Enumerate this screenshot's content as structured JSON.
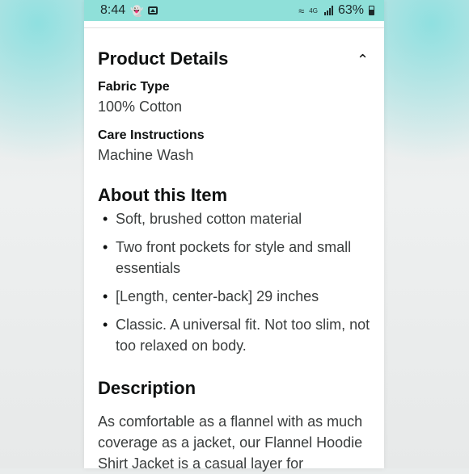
{
  "status_bar": {
    "time": "8:44",
    "network": "4G",
    "battery": "63%",
    "icons": [
      "snapchat-icon",
      "image-icon",
      "wifi-icon",
      "signal-icon",
      "battery-icon"
    ]
  },
  "product_details": {
    "title": "Product Details",
    "collapse_icon": "chevron-up-icon",
    "fields": [
      {
        "label": "Fabric Type",
        "value": "100% Cotton"
      },
      {
        "label": "Care Instructions",
        "value": "Machine Wash"
      }
    ]
  },
  "about": {
    "title": "About this Item",
    "items": [
      "Soft, brushed cotton material",
      "Two front pockets for style and small essentials",
      "[Length, center-back] 29 inches",
      "Classic. A universal fit. Not too slim, not too relaxed on body."
    ]
  },
  "description": {
    "title": "Description",
    "text": "As comfortable as a flannel with as much coverage as a jacket, our Flannel Hoodie Shirt Jacket is a casual layer for"
  }
}
